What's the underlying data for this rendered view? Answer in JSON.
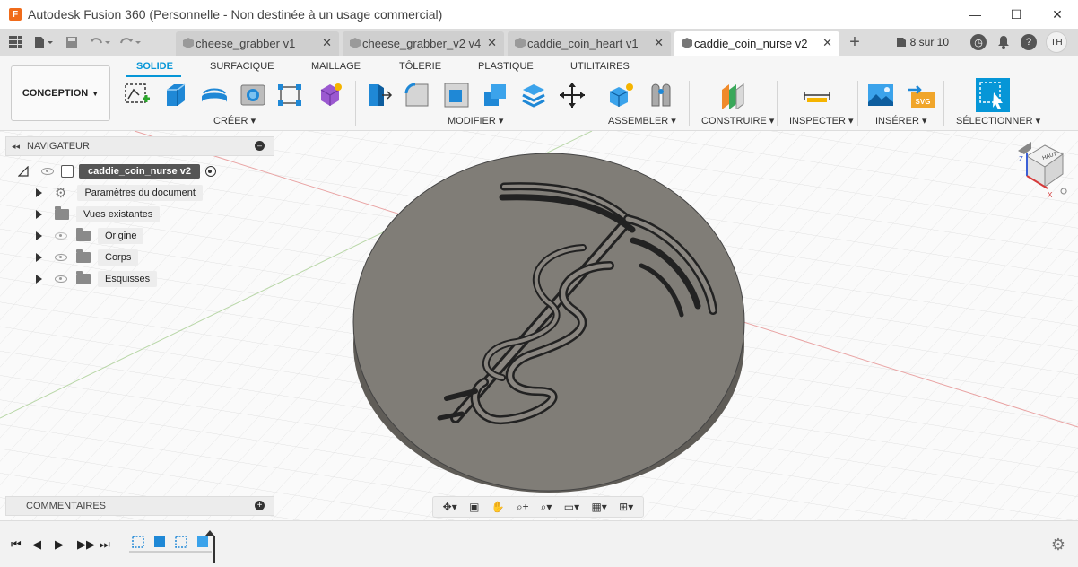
{
  "window": {
    "title": "Autodesk Fusion 360 (Personnelle - Non destinée à un usage commercial)",
    "controls": [
      "—",
      "☐",
      "✕"
    ]
  },
  "tabs": [
    {
      "label": "cheese_grabber v1",
      "active": false
    },
    {
      "label": "cheese_grabber_v2 v4",
      "active": false
    },
    {
      "label": "caddie_coin_heart v1",
      "active": false
    },
    {
      "label": "caddie_coin_nurse v2",
      "active": true
    }
  ],
  "header_right": {
    "job_status": "8 sur 10",
    "user_initials": "TH"
  },
  "toolbar": {
    "workspace": "CONCEPTION",
    "tabs": [
      "SOLIDE",
      "SURFACIQUE",
      "MAILLAGE",
      "TÔLERIE",
      "PLASTIQUE",
      "UTILITAIRES"
    ],
    "groups": {
      "create": "CRÉER",
      "modify": "MODIFIER",
      "assemble": "ASSEMBLER",
      "construct": "CONSTRUIRE",
      "inspect": "INSPECTER",
      "insert": "INSÉRER",
      "select": "SÉLECTIONNER"
    },
    "insert_badge": "SVG"
  },
  "navigator": {
    "title": "NAVIGATEUR",
    "root": "caddie_coin_nurse v2",
    "items": [
      {
        "label": "Paramètres du document"
      },
      {
        "label": "Vues existantes"
      },
      {
        "label": "Origine"
      },
      {
        "label": "Corps"
      },
      {
        "label": "Esquisses"
      }
    ]
  },
  "comments": {
    "title": "COMMENTAIRES"
  },
  "viewcube": {
    "face": "HAUT",
    "axis_z": "Z",
    "axis_x": "X"
  },
  "colors": {
    "accent": "#0696d7",
    "coin": "#807d77",
    "coin_edge": "#5f5c57"
  }
}
